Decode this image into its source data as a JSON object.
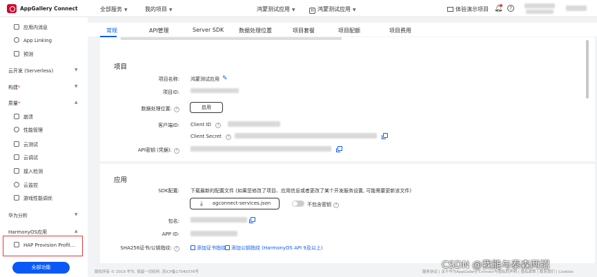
{
  "header": {
    "brand": "AppGallery Connect",
    "nav_all_services": "全部服务",
    "nav_my_projects": "我的项目",
    "project_selector": "鸿蒙测试应用",
    "app_badge": "H",
    "app_selector": "鸿蒙测试应用",
    "demo_project": "体验演示项目",
    "help_glyph": "?"
  },
  "sidebar": {
    "items": [
      {
        "label": "应用内消息",
        "icon": "message-icon"
      },
      {
        "label": "App Linking",
        "icon": "link-icon"
      },
      {
        "label": "预测",
        "icon": "prediction-icon"
      }
    ],
    "groups": {
      "cloud_dev": "云开发 (Serverless)",
      "build": "构建",
      "quality": "质量",
      "huawei_analytics": "华为分析",
      "harmonyos_app": "HarmonyOS应用"
    },
    "quality_items": [
      {
        "label": "崩溃",
        "icon": "crash-icon"
      },
      {
        "label": "性能管理",
        "icon": "performance-icon"
      },
      {
        "label": "云测试",
        "icon": "cloud-test-icon"
      },
      {
        "label": "云调试",
        "icon": "cloud-debug-icon"
      },
      {
        "label": "接入检测",
        "icon": "integration-check-icon"
      },
      {
        "label": "云监控",
        "icon": "cloud-monitor-icon"
      },
      {
        "label": "游戏性能调优",
        "icon": "game-performance-icon"
      }
    ],
    "hap_item": "HAP Provision Profil...",
    "all_functions_button": "全部功能"
  },
  "tabs": [
    "常规",
    "API管理",
    "Server SDK",
    "数据处理位置",
    "项目套餐",
    "项目配额",
    "项目费用"
  ],
  "project_section": {
    "title": "项目",
    "name_label": "项目名称:",
    "name_value": "鸿蒙测试应用",
    "id_label": "项目ID:",
    "data_location_label": "数据处理位置:",
    "data_location_button": "启用",
    "client_label": "客户端ID:",
    "client_id_label": "Client ID",
    "client_secret_label": "Client Secret",
    "api_key_label": "API密钥 (凭据):",
    "help_glyph": "?"
  },
  "app_section": {
    "title": "应用",
    "sdk_label": "SDK配置:",
    "sdk_desc": "下载最新的配置文件 (如果您修改了项目、应用信息或者更改了某个开发服务设置, 可能需要更新该文件)",
    "download_button": "agconnect-services.json",
    "no_key_label": "不包含密钥",
    "package_label": "包名:",
    "app_id_label": "APP ID:",
    "sha_label": "SHA256证书/公钥指纹:",
    "add_cert_link": "添加证书指纹",
    "add_pubkey_link": "添加公钥指纹 (HarmonyOS API 9及以上)"
  },
  "footer": {
    "copyright": "版权所有 © 2019 华为. 保留一切权利. 苏ICP备17040376号",
    "right_links": "服务协议 | 关于华为AppGallery Connect与隐私的声明 | 隐私政策 | 联系我们 | Cookies"
  },
  "watermark": "CSDN @我能与泰森两招",
  "colors": {
    "accent": "#0a59f7",
    "brand_red": "#cf0a2c",
    "highlight_box": "#e53935"
  }
}
